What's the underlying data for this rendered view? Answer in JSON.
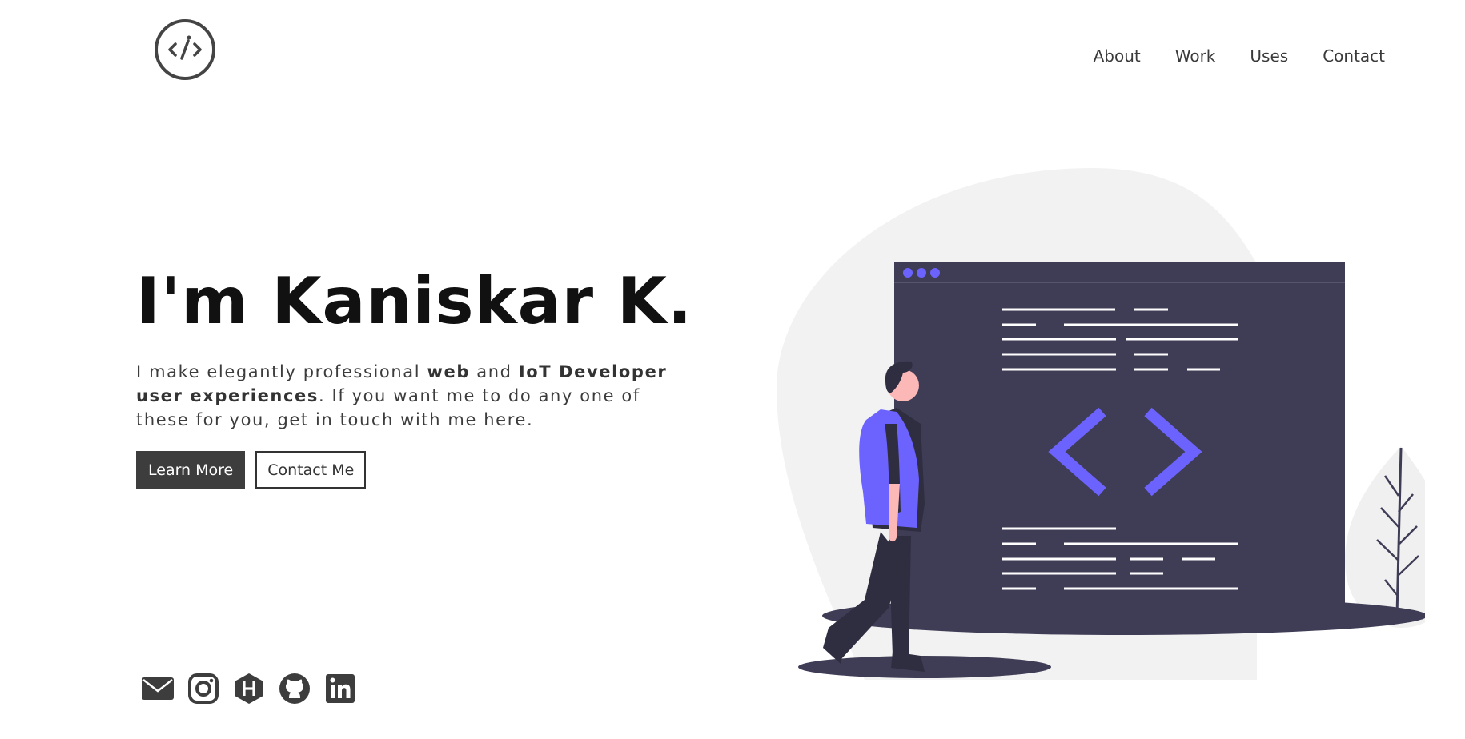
{
  "header": {
    "logo_icon": "code-circle-logo-icon",
    "nav": [
      {
        "label": "About"
      },
      {
        "label": "Work"
      },
      {
        "label": "Uses"
      },
      {
        "label": "Contact"
      }
    ]
  },
  "hero": {
    "title": "I'm Kaniskar K.",
    "intro_1": "I make elegantly professional ",
    "intro_bold_1": "web",
    "intro_2": " and ",
    "intro_bold_2": "IoT Developer user experiences",
    "intro_3": ". If you want me to do any one of these for you, get in touch with me here.",
    "learn_more_label": "Learn More",
    "contact_label": "Contact Me"
  },
  "socials": [
    {
      "icon": "email-icon"
    },
    {
      "icon": "instagram-icon"
    },
    {
      "icon": "hashnode-icon"
    },
    {
      "icon": "github-icon"
    },
    {
      "icon": "linkedin-icon"
    }
  ],
  "colors": {
    "accent": "#6c63ff",
    "dark": "#3f3d56",
    "button_dark": "#3d3d3d",
    "blob": "#f2f2f2"
  }
}
